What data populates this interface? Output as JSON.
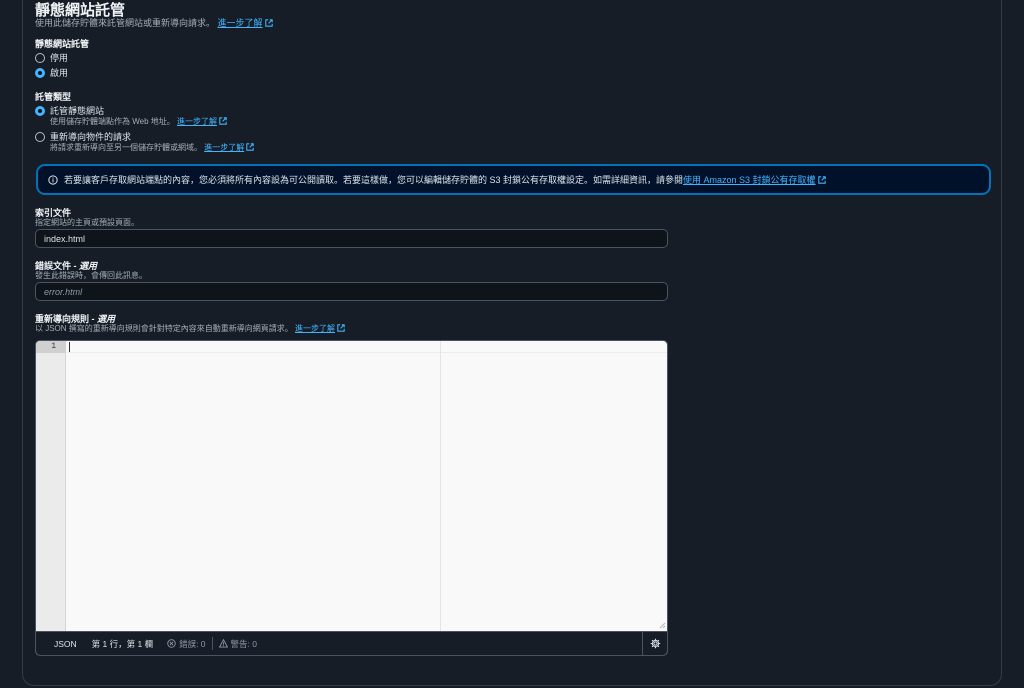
{
  "header": {
    "title": "靜態網站託管",
    "description": "使用此儲存貯體來託管網站或重新導向請求。",
    "learn_more": "進一步了解"
  },
  "hosting_toggle": {
    "label": "靜態網站託管",
    "options": [
      {
        "label": "停用",
        "selected": false
      },
      {
        "label": "啟用",
        "selected": true
      }
    ]
  },
  "hosting_type": {
    "label": "託管類型",
    "options": [
      {
        "label": "託管靜態網站",
        "desc": "使用儲存貯體端點作為 Web 地址。",
        "learn_more": "進一步了解",
        "selected": true
      },
      {
        "label": "重新導向物件的請求",
        "desc": "將請求重新導向至另一個儲存貯體或網域。",
        "learn_more": "進一步了解",
        "selected": false
      }
    ]
  },
  "info_alert": {
    "text": "若要讓客戶存取網站端點的內容，您必須將所有內容設為可公開讀取。若要這樣做，您可以編輯儲存貯體的 S3 封鎖公有存取權設定。如需詳細資訊，請參閱",
    "link": "使用 Amazon S3 封鎖公有存取權"
  },
  "index_document": {
    "label": "索引文件",
    "desc": "指定網站的主頁或預設頁面。",
    "value": "index.html"
  },
  "error_document": {
    "label": "錯誤文件",
    "optional": "選用",
    "desc": "發生此錯誤時，會傳回此訊息。",
    "placeholder": "error.html"
  },
  "redirect_rules": {
    "label": "重新導向規則",
    "optional": "選用",
    "desc": "以 JSON 撰寫的重新導向規則會針對特定內容來自動重新導向網頁請求。",
    "learn_more": "進一步了解"
  },
  "editor": {
    "line_number": "1",
    "language": "JSON",
    "position": "第 1 行，第 1 欄",
    "errors": "錯誤: 0",
    "warnings": "警告: 0"
  },
  "colors": {
    "accent": "#42b4ff",
    "info_border": "#0073bb",
    "background": "#161d26"
  }
}
